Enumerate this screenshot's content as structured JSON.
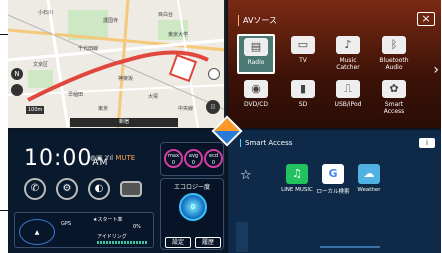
{
  "map": {
    "labels": [
      "小石川",
      "護国寺",
      "目白台",
      "千代田線",
      "東京大学",
      "文京区",
      "神楽坂",
      "大塚",
      "早稲田",
      "中央線",
      "東京"
    ],
    "scale": "100m",
    "status": "新宿",
    "compass": "N"
  },
  "av": {
    "title": "AVソース",
    "close": "×",
    "tiles": [
      {
        "label": "Radio",
        "icon": "radio-icon",
        "glyph": "▤"
      },
      {
        "label": "TV",
        "icon": "tv-icon",
        "glyph": "▭"
      },
      {
        "label": "Music Catcher",
        "icon": "music-catcher-icon",
        "glyph": "♪"
      },
      {
        "label": "Bluetooth Audio",
        "icon": "bluetooth-icon",
        "glyph": "ᛒ"
      },
      {
        "label": "DVD/CD",
        "icon": "disc-icon",
        "glyph": "◉"
      },
      {
        "label": "SD",
        "icon": "sd-card-icon",
        "glyph": "▮"
      },
      {
        "label": "USB/iPod",
        "icon": "usb-icon",
        "glyph": "⎍"
      },
      {
        "label": "Smart Access",
        "icon": "smart-access-icon",
        "glyph": "✿"
      }
    ]
  },
  "info": {
    "time": "10:00",
    "ampm": "AM",
    "mute": "MUTE",
    "gauges": [
      {
        "label": "max",
        "value": "0"
      },
      {
        "label": "avg",
        "value": "0"
      },
      {
        "label": "ecd",
        "value": "0"
      }
    ],
    "gauge_units": [
      "g/h",
      "",
      "km"
    ],
    "eco_title": "エコロジー度",
    "eco_value": "0",
    "btn_settings": "設定",
    "btn_history": "履歴",
    "gps": "GPS",
    "start_label": "★スタート率",
    "start_value": "0%",
    "idle_label": "アイドリング"
  },
  "smart": {
    "title": "Smart Access",
    "apps": [
      {
        "label": "LINE MUSIC",
        "icon": "line-music-icon",
        "color": "#22c35e",
        "glyph": "♫"
      },
      {
        "label": "ローカル検索",
        "icon": "google-icon",
        "color": "#ffffff",
        "glyph": "G"
      },
      {
        "label": "Weather",
        "icon": "weather-icon",
        "color": "#4fb2e0",
        "glyph": "☁"
      }
    ]
  }
}
